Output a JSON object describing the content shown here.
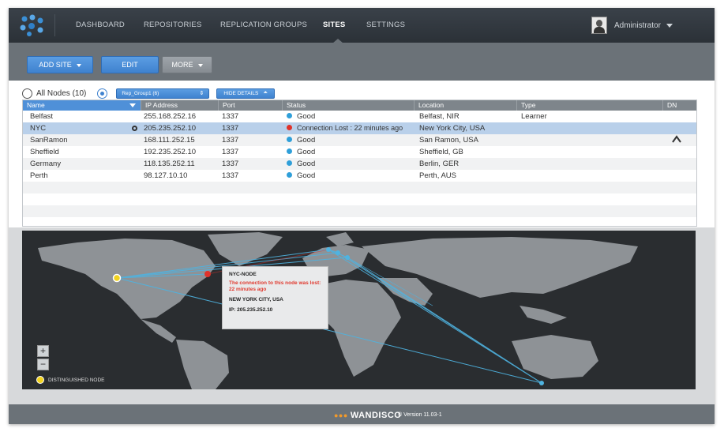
{
  "nav": {
    "items": [
      "DASHBOARD",
      "REPOSITORIES",
      "REPLICATION GROUPS",
      "SITES",
      "SETTINGS"
    ],
    "active": "SITES",
    "user": "Administrator"
  },
  "toolbar": {
    "add_site": "ADD SITE",
    "edit": "EDIT",
    "more": "MORE"
  },
  "filter": {
    "all_nodes_label": "All Nodes (10)",
    "group_select_value": "Rep_Group1 (6)",
    "hide_details": "HIDE DETAILS"
  },
  "table": {
    "columns": [
      "Name",
      "IP Address",
      "Port",
      "Status",
      "Location",
      "Type",
      "DN"
    ],
    "rows": [
      {
        "name": "Belfast",
        "ip": "255.168.252.16",
        "port": "1337",
        "status": "Good",
        "status_color": "#2f9fd9",
        "location": "Belfast, NIR",
        "type": "Learner"
      },
      {
        "name": "NYC",
        "ip": "205.235.252.10",
        "port": "1337",
        "status": "Connection Lost : 22 minutes ago",
        "status_color": "#e0322a",
        "location": "New York City, USA",
        "type": ""
      },
      {
        "name": "SanRamon",
        "ip": "168.111.252.15",
        "port": "1337",
        "status": "Good",
        "status_color": "#2f9fd9",
        "location": "San Ramon, USA",
        "type": ""
      },
      {
        "name": "Sheffield",
        "ip": "192.235.252.10",
        "port": "1337",
        "status": "Good",
        "status_color": "#2f9fd9",
        "location": "Sheffield, GB",
        "type": ""
      },
      {
        "name": "Germany",
        "ip": "118.135.252.11",
        "port": "1337",
        "status": "Good",
        "status_color": "#2f9fd9",
        "location": "Berlin, GER",
        "type": ""
      },
      {
        "name": "Perth",
        "ip": "98.127.10.10",
        "port": "1337",
        "status": "Good",
        "status_color": "#2f9fd9",
        "location": "Perth, AUS",
        "type": ""
      }
    ]
  },
  "map": {
    "tooltip": {
      "title": "NYC-NODE",
      "message": "The connection to this node was lost:",
      "since": "22 minutes ago",
      "location": "NEW YORK CITY, USA",
      "ip": "IP: 205.235.252.10"
    },
    "legend": "DISTINGUISHED NODE",
    "zoom_in": "+",
    "zoom_out": "−"
  },
  "footer": {
    "brand": "WANDISCO",
    "version": "Version 11.03-1"
  },
  "colors": {
    "accent": "#3f82cf",
    "good": "#2f9fd9",
    "lost": "#e0322a",
    "distinguished": "#f1d21f"
  }
}
